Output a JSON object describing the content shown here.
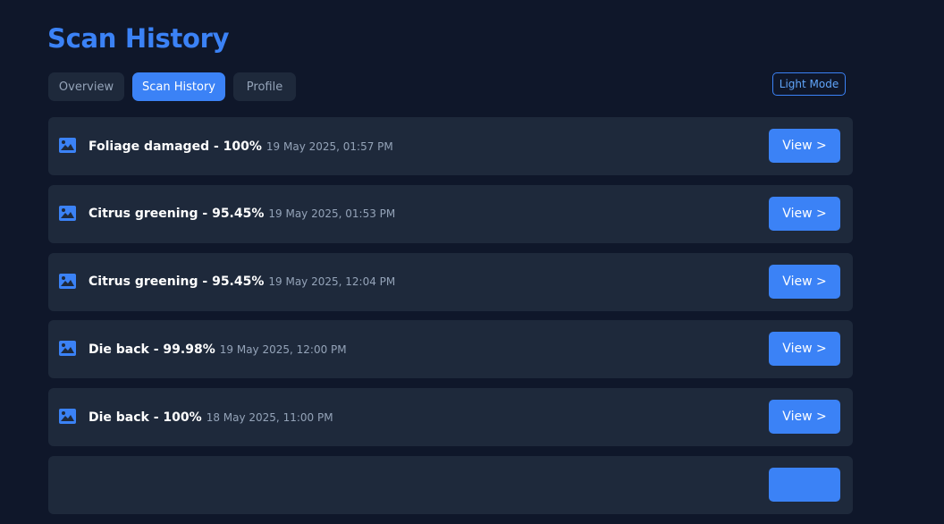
{
  "page": {
    "title": "Scan History"
  },
  "tabs": [
    {
      "label": "Overview",
      "active": false
    },
    {
      "label": "Scan History",
      "active": true
    },
    {
      "label": "Profile",
      "active": false
    }
  ],
  "theme_toggle": {
    "label": "Light Mode"
  },
  "colors": {
    "accent": "#3b82f6",
    "background": "#0f172a",
    "card": "#1e293b",
    "muted_text": "#94a3b8"
  },
  "scans": [
    {
      "icon": "image-icon",
      "result": "Foliage damaged - 100%",
      "timestamp": "19 May 2025, 01:57 PM",
      "action": "View >"
    },
    {
      "icon": "image-icon",
      "result": "Citrus greening - 95.45%",
      "timestamp": "19 May 2025, 01:53 PM",
      "action": "View >"
    },
    {
      "icon": "image-icon",
      "result": "Citrus greening - 95.45%",
      "timestamp": "19 May 2025, 12:04 PM",
      "action": "View >"
    },
    {
      "icon": "image-icon",
      "result": "Die back - 99.98%",
      "timestamp": "19 May 2025, 12:00 PM",
      "action": "View >"
    },
    {
      "icon": "image-icon",
      "result": "Die back - 100%",
      "timestamp": "18 May 2025, 11:00 PM",
      "action": "View >"
    }
  ]
}
